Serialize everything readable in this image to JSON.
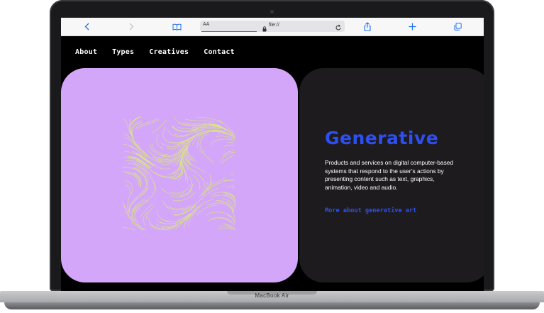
{
  "device": {
    "label": "MacBook Air"
  },
  "browser": {
    "text_size_label": "AA",
    "url": "file://",
    "icons": [
      "back-chevron-icon",
      "forward-chevron-icon",
      "bookmarks-book-icon",
      "lock-icon",
      "reload-icon",
      "share-icon",
      "new-tab-plus-icon",
      "tabs-icon"
    ]
  },
  "nav": {
    "items": [
      {
        "label": "About"
      },
      {
        "label": "Types"
      },
      {
        "label": "Creatives"
      },
      {
        "label": "Contact"
      }
    ]
  },
  "hero": {
    "title": "Generative",
    "description": "Products and services on digital computer-based systems that respond to the user’s actions by presenting content such as text, graphics, animation, video and audio.",
    "link_label": "More about generative art"
  },
  "colors": {
    "accent_blue": "#2e4ff0",
    "card_lilac": "#d4a6f9",
    "card_dark": "#1d1b1e",
    "art_lines": "#d9f26b",
    "browser_icon_blue": "#1e6ff5"
  }
}
